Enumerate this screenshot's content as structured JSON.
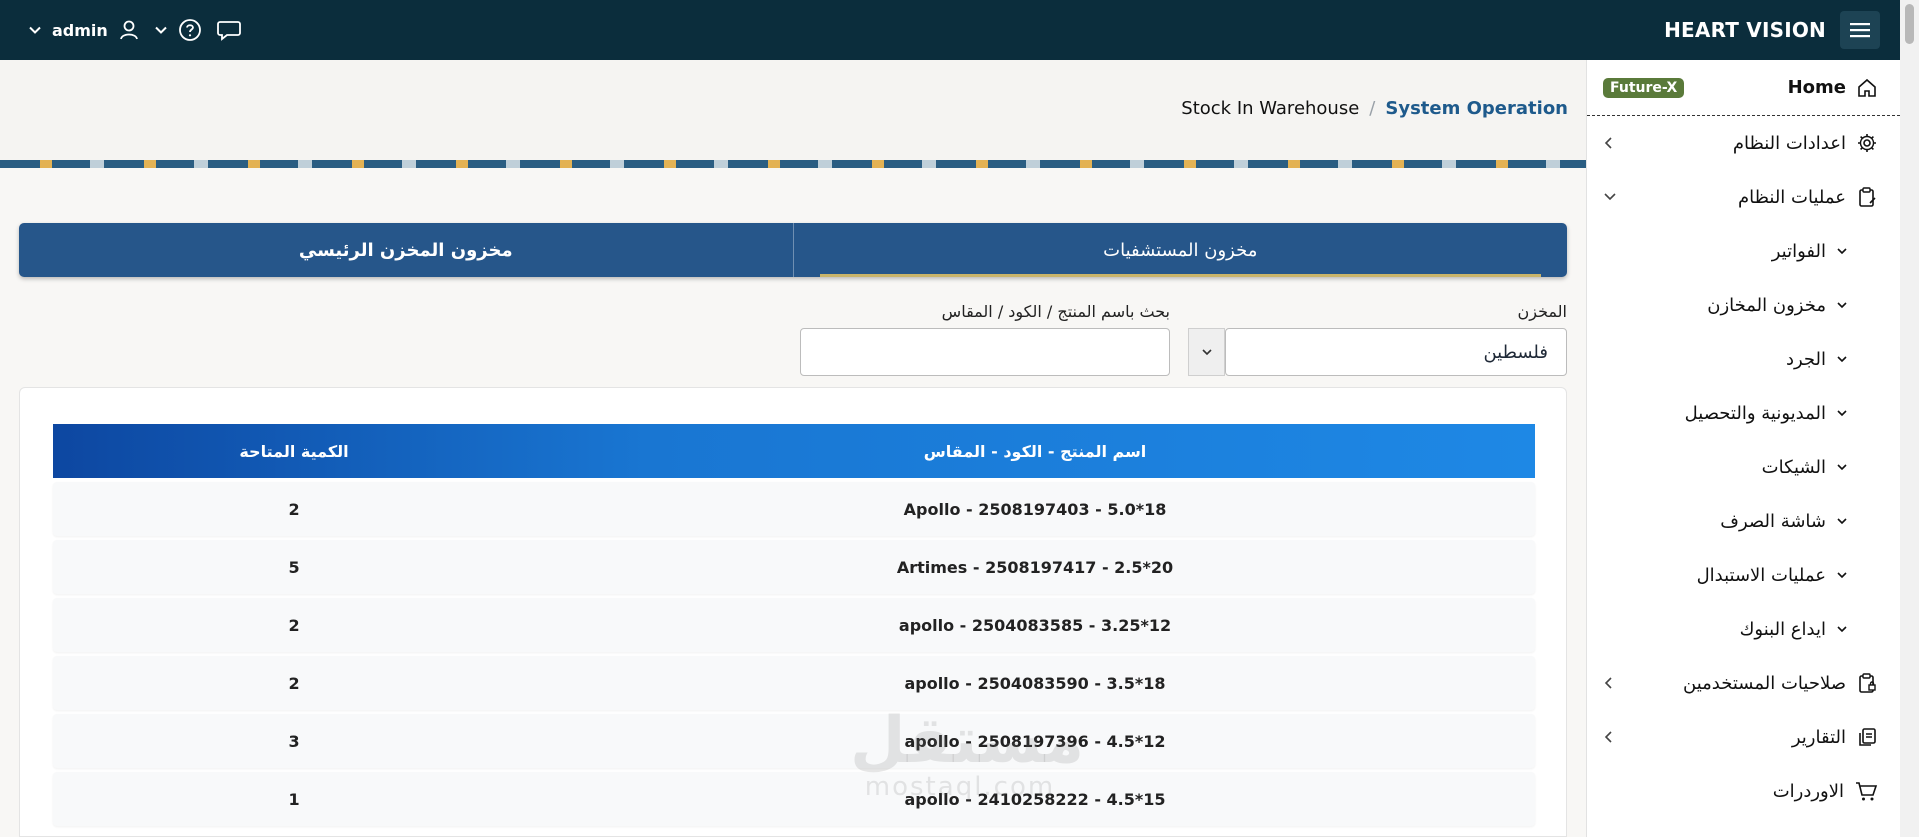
{
  "header": {
    "brand": "HEART VISION",
    "user_name": "admin"
  },
  "sidebar": {
    "home_label": "Home",
    "badge": "Future-X",
    "items": [
      {
        "label": "اعدادات النظام"
      },
      {
        "label": "عمليات النظام"
      }
    ],
    "subitems": [
      {
        "label": "الفواتير"
      },
      {
        "label": "مخزون المخازن"
      },
      {
        "label": "الجرد"
      },
      {
        "label": "المديونية والتحصيل"
      },
      {
        "label": "الشيكات"
      },
      {
        "label": "شاشة الصرف"
      },
      {
        "label": "عمليات الاستبدال"
      },
      {
        "label": "ايداع البنوك"
      }
    ],
    "bottom_items": [
      {
        "label": "صلاحيات المستخدمين"
      },
      {
        "label": "التقارير"
      },
      {
        "label": "الاوردرات"
      }
    ]
  },
  "breadcrumb": {
    "parent": "System Operation",
    "separator": "/",
    "current": "Stock In Warehouse"
  },
  "tabs": [
    {
      "label": "مخزون المستشفيات"
    },
    {
      "label": "مخزون المخزن الرئيسي"
    }
  ],
  "filters": {
    "warehouse_label": "المخزن",
    "warehouse_value": "فلسطين",
    "search_label": "بحث باسم المنتج / الكود / المقاس",
    "search_value": ""
  },
  "table": {
    "headers": {
      "name": "اسم المنتج - الكود - المقاس",
      "qty": "الكمية المتاحة"
    },
    "rows": [
      {
        "name": "Apollo - 2508197403 - 5.0*18",
        "qty": "2"
      },
      {
        "name": "Artimes - 2508197417 - 2.5*20",
        "qty": "5"
      },
      {
        "name": "apollo - 2504083585 - 3.25*12",
        "qty": "2"
      },
      {
        "name": "apollo - 2504083590 - 3.5*18",
        "qty": "2"
      },
      {
        "name": "apollo - 2508197396 - 4.5*12",
        "qty": "3"
      },
      {
        "name": "apollo - 2410258222 - 4.5*15",
        "qty": "1"
      }
    ]
  },
  "watermark": {
    "line1": "مستقل",
    "line2": "mostaql.com"
  },
  "colors": {
    "header_bg": "#0b2d3c",
    "tab_bg": "#26568a",
    "link": "#1e5a8c",
    "badge_bg": "#5a7a3a"
  }
}
